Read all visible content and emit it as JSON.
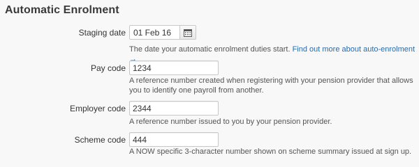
{
  "section_title": "Automatic Enrolment",
  "staging_date": {
    "label": "Staging date",
    "value": "01 Feb 16",
    "help": "The date your automatic enrolment duties start.",
    "link": "Find out more about auto-enrolment →"
  },
  "pay_code": {
    "label": "Pay code",
    "value": "1234",
    "help": "A reference number created when registering with your pension provider that allows you to identify one payroll from another."
  },
  "employer_code": {
    "label": "Employer code",
    "value": "2344",
    "help": "A reference number issued to you by your pension provider."
  },
  "scheme_code": {
    "label": "Scheme code",
    "value": "444",
    "help": "A NOW specific 3-character number shown on scheme summary issued at sign up."
  },
  "link_color": "#2a6aa8"
}
